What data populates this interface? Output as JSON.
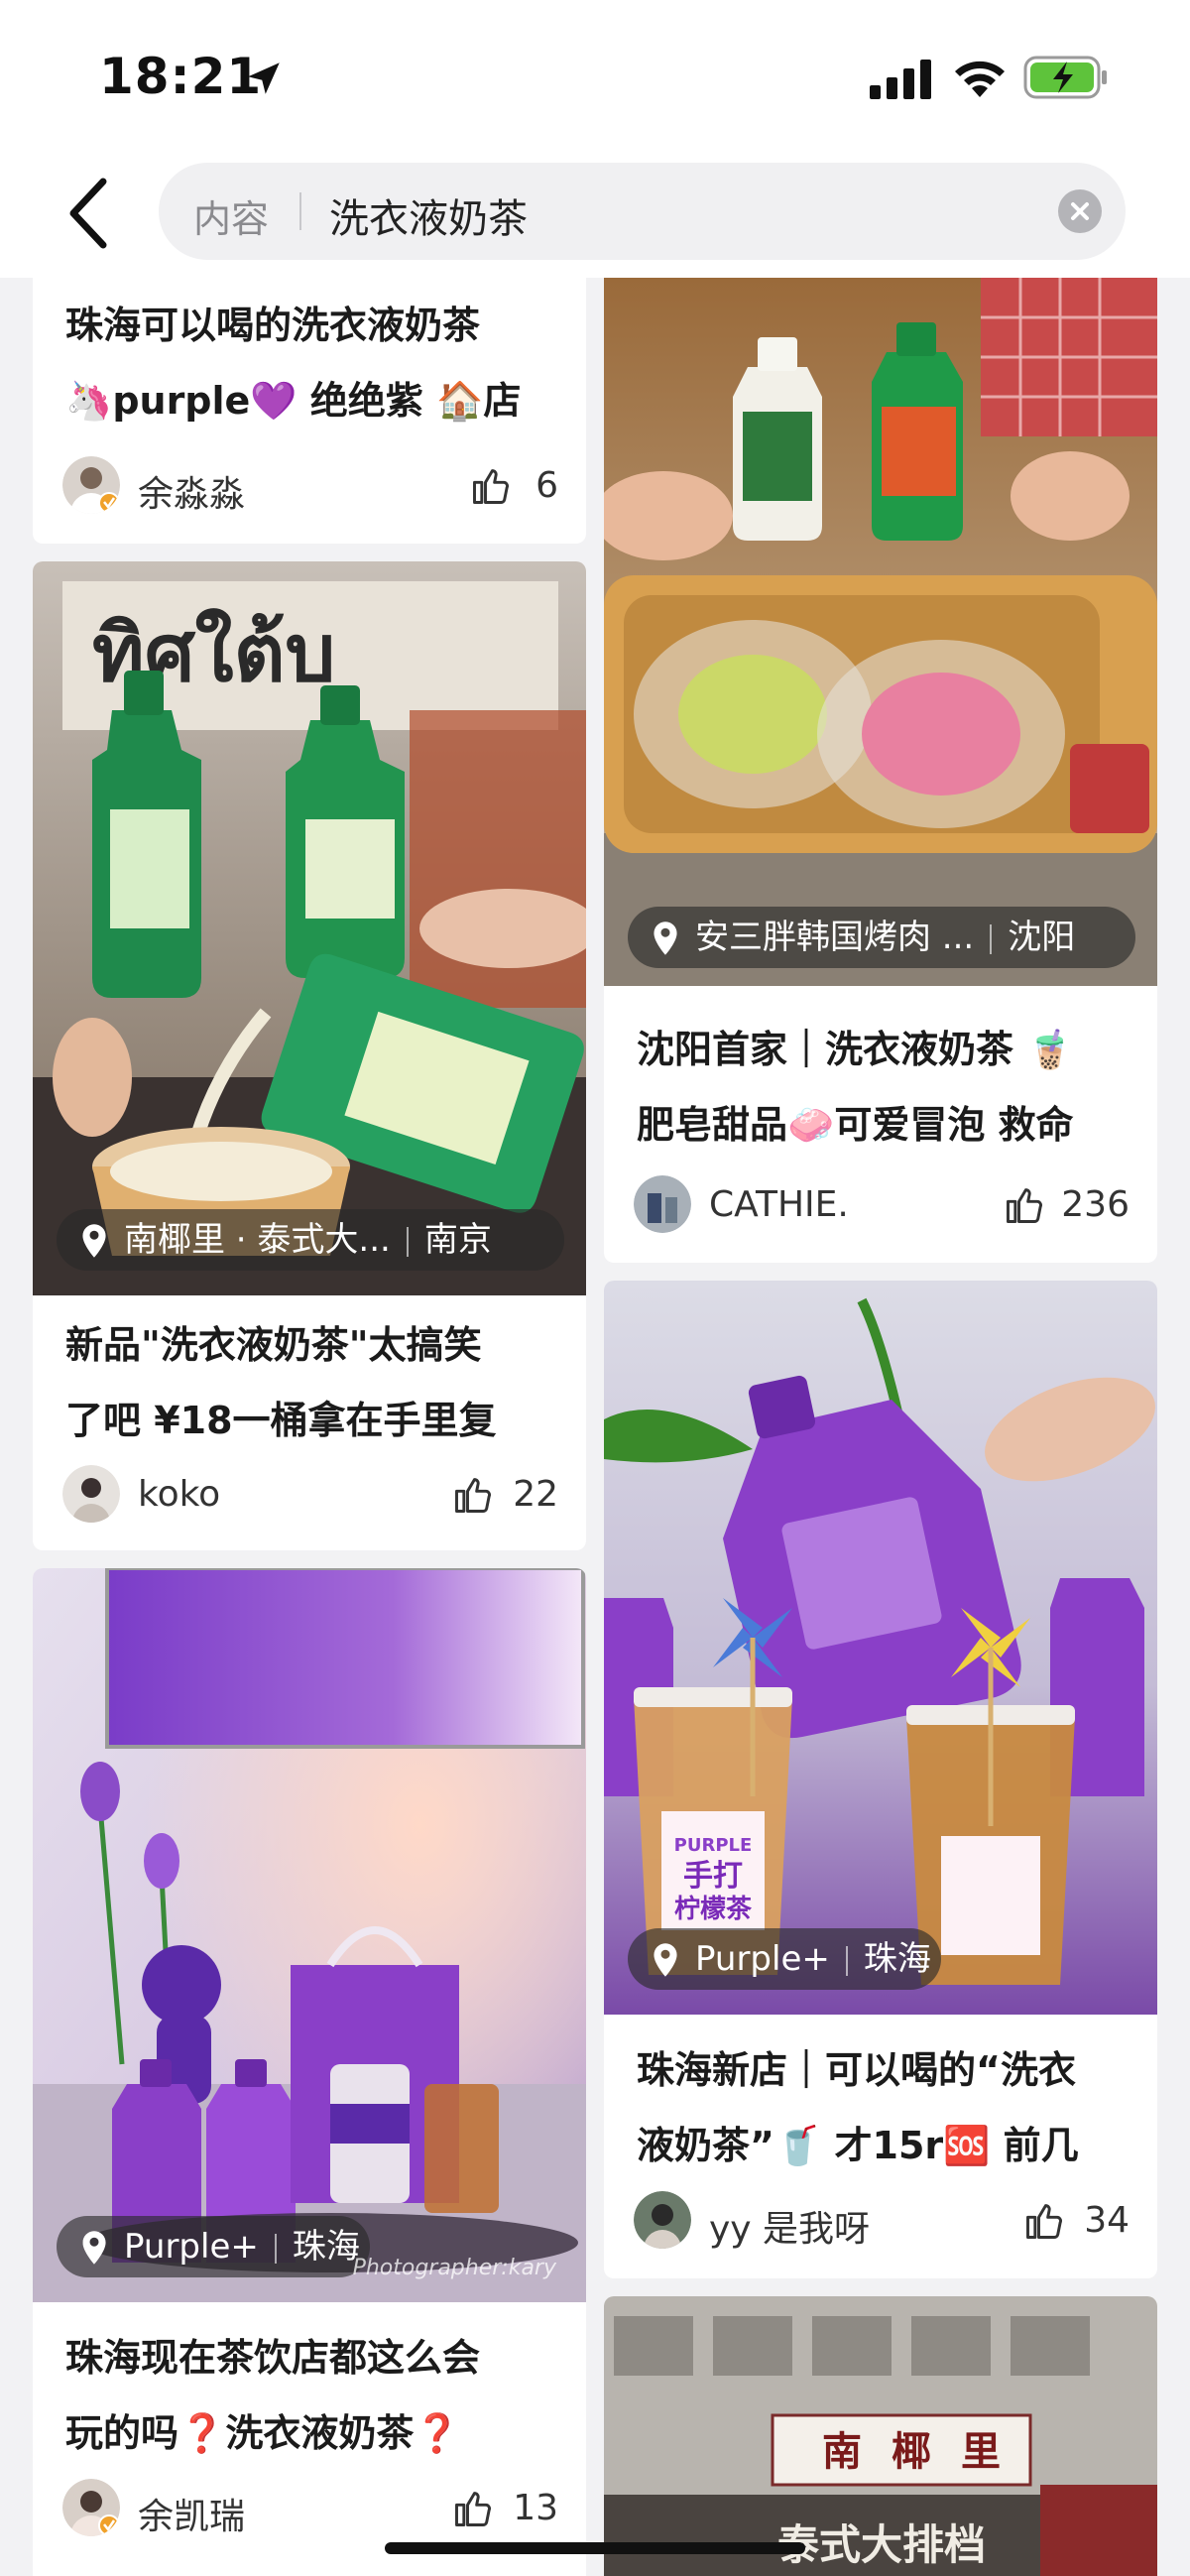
{
  "status_bar": {
    "time": "18:21",
    "icons": [
      "location-arrow-icon",
      "signal-icon",
      "wifi-icon",
      "battery-charging-icon"
    ],
    "battery_color": "#5ec33b"
  },
  "search": {
    "type_label": "内容",
    "query": "洗衣液奶茶"
  },
  "feed": {
    "left": [
      {
        "title_lines": [
          "珠海可以喝的洗衣液奶茶",
          "🦄purple💜 绝绝紫 🏠店"
        ],
        "author": "余淼淼",
        "likes": "6"
      },
      {
        "location": "南椰里 · 泰式大...",
        "city": "南京",
        "title_lines": [
          "新品\"洗衣液奶茶\"太搞笑",
          "了吧 ¥18一桶拿在手里复"
        ],
        "author": "koko",
        "likes": "22"
      },
      {
        "location": "Purple+",
        "city": "珠海",
        "photo_credit": "Photographer:kary",
        "title_lines": [
          "珠海现在茶饮店都这么会",
          "玩的吗❓洗衣液奶茶❓"
        ],
        "author": "余凯瑞",
        "likes": "13"
      }
    ],
    "right": [
      {
        "location": "安三胖韩国烤肉 ...",
        "city": "沈阳",
        "title_lines": [
          "沈阳首家｜洗衣液奶茶 🧋",
          "肥皂甜品🧼可爱冒泡 救命"
        ],
        "author": "CATHIE.",
        "likes": "236"
      },
      {
        "location": "Purple+",
        "city": "珠海",
        "image_text": [
          "PURPLE",
          "手打",
          "柠檬茶"
        ],
        "title_lines": [
          "珠海新店｜可以喝的“洗衣",
          "液奶茶”🥤 才15r🆘 前几"
        ],
        "author": "yy 是我呀",
        "likes": "34"
      },
      {
        "image_text": [
          "南",
          "椰",
          "里",
          "泰式大排档"
        ]
      }
    ]
  },
  "colors": {
    "accent_purple": "#8a3fc8",
    "bottle_green": "#1f8a4c",
    "text_dark": "#1b1b1b",
    "text_meta": "#333333"
  }
}
